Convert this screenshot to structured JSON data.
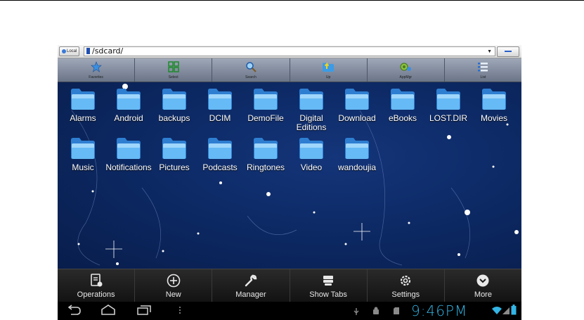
{
  "pathbar": {
    "local_label": "Local",
    "path": "/sdcard/"
  },
  "toolbar": {
    "buttons": [
      {
        "label": "Favorites",
        "icon": "star-icon"
      },
      {
        "label": "Select",
        "icon": "select-grid-icon"
      },
      {
        "label": "Search",
        "icon": "search-icon"
      },
      {
        "label": "Up",
        "icon": "folder-up-icon"
      },
      {
        "label": "AppMgr",
        "icon": "android-gear-icon"
      },
      {
        "label": "List",
        "icon": "list-view-icon"
      }
    ]
  },
  "folders": [
    "Alarms",
    "Android",
    "backups",
    "DCIM",
    "DemoFile",
    "Digital Editions",
    "Download",
    "eBooks",
    "LOST.DIR",
    "Movies",
    "Music",
    "Notifications",
    "Pictures",
    "Podcasts",
    "Ringtones",
    "Video",
    "wandoujia"
  ],
  "menu": {
    "items": [
      {
        "label": "Operations",
        "icon": "operations-icon"
      },
      {
        "label": "New",
        "icon": "add-circle-icon"
      },
      {
        "label": "Manager",
        "icon": "wrench-icon"
      },
      {
        "label": "Show Tabs",
        "icon": "tabs-stack-icon"
      },
      {
        "label": "Settings",
        "icon": "gear-icon"
      },
      {
        "label": "More",
        "icon": "more-chevron-icon"
      }
    ]
  },
  "statusbar": {
    "time": "9:46PM",
    "accent_color": "#33b5e5"
  },
  "colors": {
    "wallpaper": "#0d2a66",
    "folder_blue": "#4fa9ef"
  }
}
